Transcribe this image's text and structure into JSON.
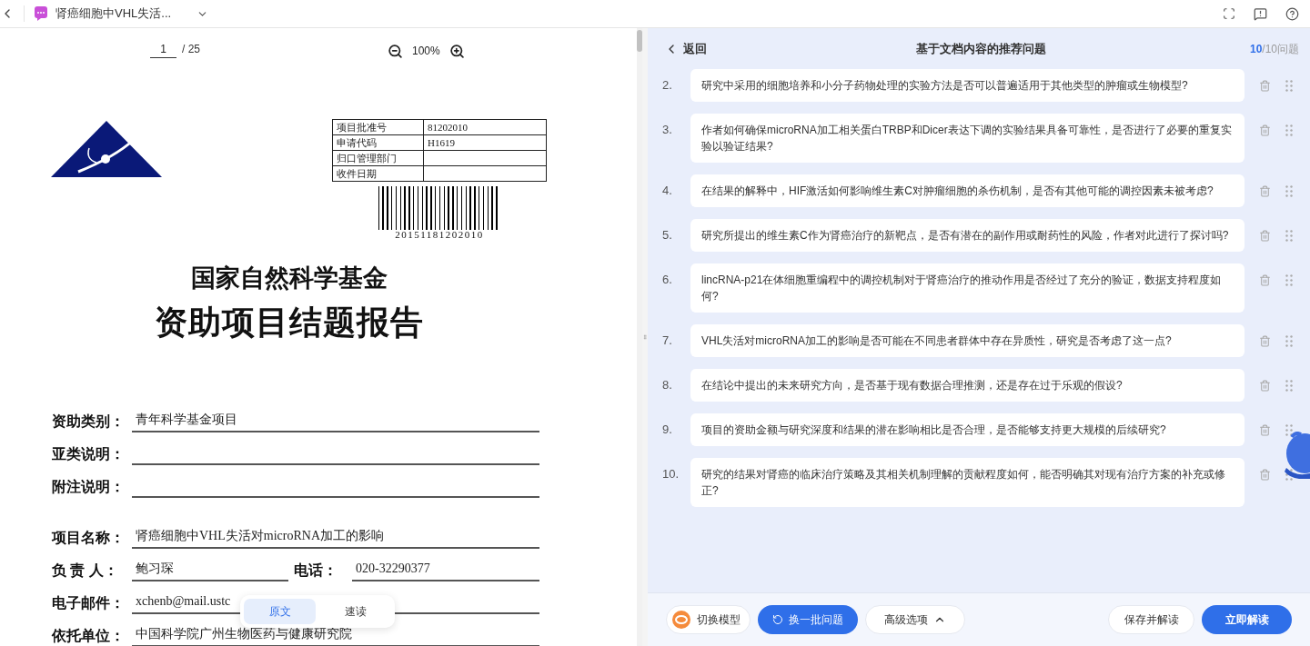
{
  "top_bar": {
    "doc_title": "肾癌细胞中VHL失活..."
  },
  "viewer": {
    "page": "1",
    "page_total": "/ 25",
    "zoom": "100%"
  },
  "document": {
    "table": [
      {
        "label": "项目批准号",
        "value": "81202010"
      },
      {
        "label": "申请代码",
        "value": "H1619"
      },
      {
        "label": "归口管理部门"
      },
      {
        "label": "收件日期"
      }
    ],
    "barcode_number": "20151181202010",
    "title": "国家自然科学基金",
    "subtitle": "资助项目结题报告",
    "field_groups": [
      [
        {
          "kind": "line",
          "label": "资助类别：",
          "value": "青年科学基金项目"
        },
        {
          "kind": "line",
          "label": "亚类说明："
        },
        {
          "kind": "line",
          "label": "附注说明："
        }
      ],
      [
        {
          "kind": "line",
          "label": "项目名称：",
          "value": "肾癌细胞中VHL失活对microRNA加工的影响"
        },
        {
          "kind": "pair",
          "label": "负 责 人：",
          "value": "鲍习琛",
          "label2": "电话：",
          "value2": "020-32290377"
        },
        {
          "kind": "line",
          "label": "电子邮件：",
          "value": "xchenb@mail.ustc"
        },
        {
          "kind": "line",
          "label": "依托单位：",
          "value": "中国科学院广州生物医药与健康研究院"
        }
      ]
    ]
  },
  "view_toggle": [
    {
      "label": "原文",
      "selected": true
    },
    {
      "label": "速读",
      "selected": false
    }
  ],
  "panel": {
    "back": "返回",
    "title": "基于文档内容的推荐问题",
    "count_current": "10",
    "count_total": "/10问题",
    "questions": [
      {
        "number": "2.",
        "text": "研究中采用的细胞培养和小分子药物处理的实验方法是否可以普遍适用于其他类型的肿瘤或生物模型?"
      },
      {
        "number": "3.",
        "text": "作者如何确保microRNA加工相关蛋白TRBP和Dicer表达下调的实验结果具备可靠性，是否进行了必要的重复实验以验证结果?"
      },
      {
        "number": "4.",
        "text": "在结果的解释中，HIF激活如何影响维生素C对肿瘤细胞的杀伤机制，是否有其他可能的调控因素未被考虑?"
      },
      {
        "number": "5.",
        "text": "研究所提出的维生素C作为肾癌治疗的新靶点，是否有潜在的副作用或耐药性的风险，作者对此进行了探讨吗?"
      },
      {
        "number": "6.",
        "text": "lincRNA-p21在体细胞重编程中的调控机制对于肾癌治疗的推动作用是否经过了充分的验证，数据支持程度如何?"
      },
      {
        "number": "7.",
        "text": "VHL失活对microRNA加工的影响是否可能在不同患者群体中存在异质性，研究是否考虑了这一点?"
      },
      {
        "number": "8.",
        "text": "在结论中提出的未来研究方向，是否基于现有数据合理推测，还是存在过于乐观的假设?"
      },
      {
        "number": "9.",
        "text": "项目的资助金额与研究深度和结果的潜在影响相比是否合理，是否能够支持更大规模的后续研究?"
      },
      {
        "number": "10.",
        "text": "研究的结果对肾癌的临床治疗策略及其相关机制理解的贡献程度如何，能否明确其对现有治疗方案的补充或修正?"
      }
    ]
  },
  "footer": {
    "buttons": [
      {
        "kind": "model",
        "label": "切换模型"
      },
      {
        "kind": "refresh",
        "label": "换一批问题"
      },
      {
        "kind": "options",
        "label": "高级选项"
      },
      {
        "kind": "secondary",
        "label": "保存并解读"
      },
      {
        "kind": "primary",
        "label": "立即解读"
      }
    ]
  }
}
